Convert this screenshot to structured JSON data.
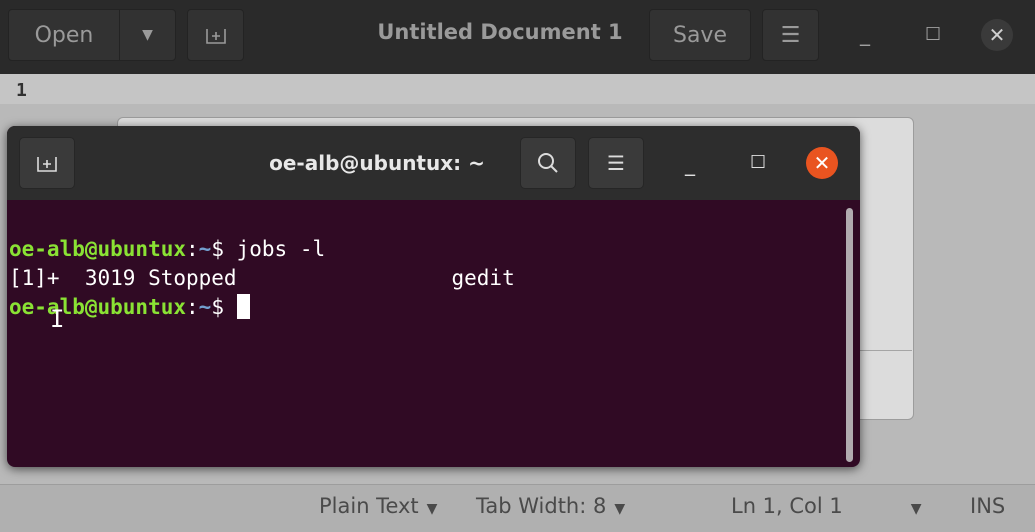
{
  "gedit": {
    "open_label": "Open",
    "title": "Untitled Document 1",
    "save_label": "Save",
    "line_number": "1"
  },
  "terminal": {
    "title": "oe-alb@ubuntux: ~",
    "lines": [
      {
        "user": "oe-alb@ubuntux",
        "sep": ":",
        "path": "~",
        "cmd": "$ jobs -l"
      },
      {
        "text": "[1]+  3019 Stopped                 gedit"
      },
      {
        "user": "oe-alb@ubuntux",
        "sep": ":",
        "path": "~",
        "cmd": "$ "
      }
    ]
  },
  "statusbar": {
    "language": "Plain Text",
    "tab_width": "Tab Width: 8",
    "position": "Ln 1, Col 1",
    "mode": "INS"
  }
}
